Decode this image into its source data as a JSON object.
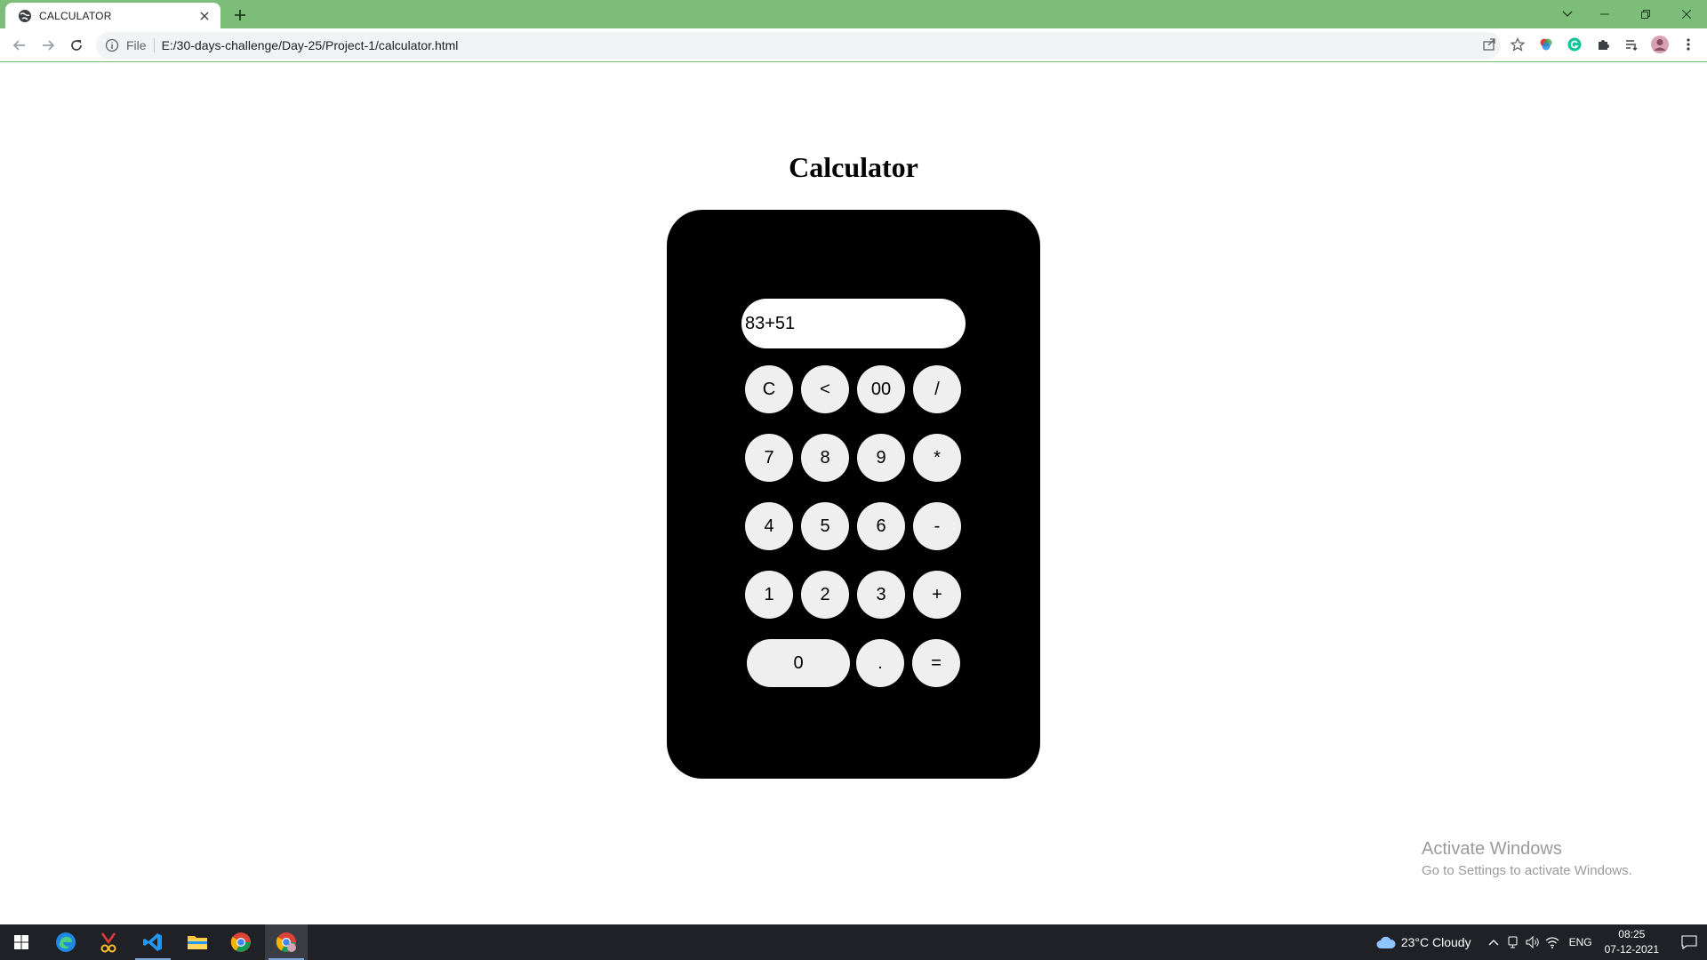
{
  "browser": {
    "tab_title": "CALCULATOR",
    "address_scheme": "File",
    "address_url": "E:/30-days-challenge/Day-25/Project-1/calculator.html"
  },
  "page": {
    "title": "Calculator",
    "display_value": "83+51",
    "keys": {
      "clear": "C",
      "backspace": "<",
      "double_zero": "00",
      "divide": "/",
      "seven": "7",
      "eight": "8",
      "nine": "9",
      "multiply": "*",
      "four": "4",
      "five": "5",
      "six": "6",
      "subtract": "-",
      "one": "1",
      "two": "2",
      "three": "3",
      "add": "+",
      "zero": "0",
      "decimal": ".",
      "equals": "="
    }
  },
  "watermark": {
    "line1": "Activate Windows",
    "line2": "Go to Settings to activate Windows."
  },
  "taskbar": {
    "weather": "23°C  Cloudy",
    "language": "ENG",
    "time": "08:25",
    "date": "07-12-2021"
  },
  "colors": {
    "chrome_frame": "#7cbd7a",
    "calculator_body": "#000000",
    "key_background": "#efefef",
    "taskbar": "#1f2126"
  }
}
